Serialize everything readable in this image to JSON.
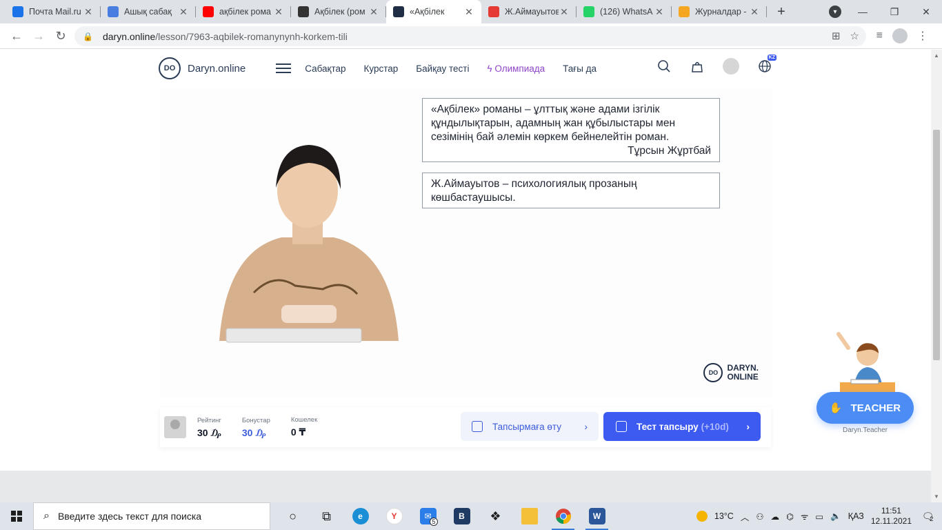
{
  "browser": {
    "tabs": [
      {
        "title": "Почта Mail.ru",
        "icon": "mail-icon",
        "color": "#1a73e8"
      },
      {
        "title": "Ашық сабақ",
        "icon": "u-icon",
        "color": "#4a7de0"
      },
      {
        "title": "ақбілек рома",
        "icon": "youtube-icon",
        "color": "#ff0000"
      },
      {
        "title": "Ақбілек (ром",
        "icon": "wikipedia-icon",
        "color": "#333333"
      },
      {
        "title": "«Ақбілек",
        "icon": "daryn-icon",
        "color": "#1f2d45",
        "active": true
      },
      {
        "title": "Ж.Аймауытов",
        "icon": "b-icon",
        "color": "#e53935"
      },
      {
        "title": "(126) WhatsA",
        "icon": "whatsapp-icon",
        "color": "#25d366"
      },
      {
        "title": "Журналдар -",
        "icon": "bulb-icon",
        "color": "#f5a623"
      }
    ],
    "new_tab": "+",
    "url_host": "daryn.online",
    "url_path": "/lesson/7963-aqbilek-romanynynh-korkem-tili"
  },
  "site": {
    "logo_badge": "DO",
    "logo_name": "Daryn.online",
    "menu": [
      "Сабақтар",
      "Курстар",
      "Байқау тесті",
      "Олимпиада",
      "Тағы да"
    ],
    "lang_badge": "KZ"
  },
  "video": {
    "quote_lines": [
      "«Ақбілек» романы – ұлттық және адами ізгілік",
      "құндылықтарын, адамның жан құбылыстары мен",
      "сезімінің бай әлемін көркем бейнелейтін роман."
    ],
    "quote_author": "Тұрсын Жұртбай",
    "fact_lines": [
      "Ж.Аймауытов – психологиялық прозаның",
      "көшбастаушысы."
    ],
    "watermark_badge": "DO",
    "watermark_line1": "DARYN.",
    "watermark_line2": "ONLINE"
  },
  "lesson_bar": {
    "rating_label": "Рейтинг",
    "rating_value": "30 ₯",
    "bonus_label": "Бонустар",
    "bonus_value": "30 ₯",
    "wallet_label": "Кошелек",
    "wallet_value": "0 ₸",
    "task_button": "Тапсырмаға өту",
    "test_button": "Тест тапсыру",
    "test_bonus": "(+10d)"
  },
  "teacher_widget": {
    "button": "TEACHER",
    "caption": "Daryn.Teacher"
  },
  "taskbar": {
    "search_placeholder": "Введите здесь текст для поиска",
    "mail_badge": "5",
    "temperature": "13°C",
    "language": "ҚАЗ",
    "time": "11:51",
    "date": "12.11.2021",
    "notifications": "2"
  }
}
